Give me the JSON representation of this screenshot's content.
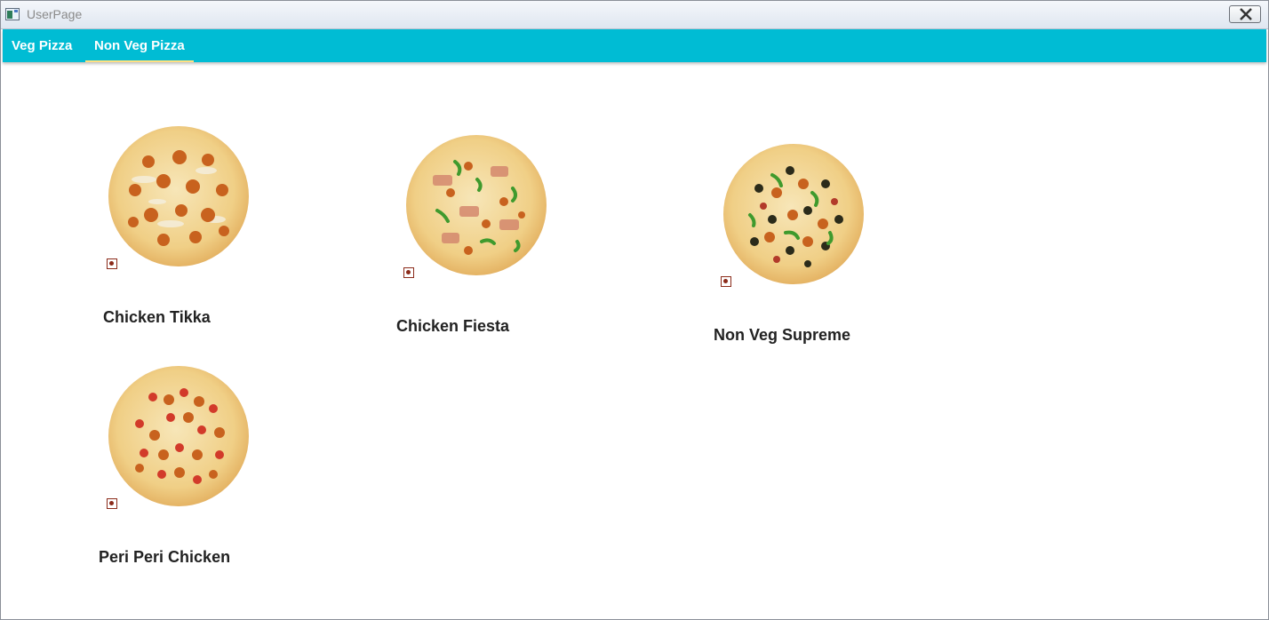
{
  "window": {
    "title": "UserPage"
  },
  "tabs": [
    {
      "label": "Veg Pizza",
      "active": false
    },
    {
      "label": "Non Veg Pizza",
      "active": true
    }
  ],
  "pizzas": [
    {
      "name": "Chicken Tikka",
      "icon": "non-veg-icon",
      "topping_colors": [
        "#c8621e",
        "#f4efe0"
      ]
    },
    {
      "name": "Chicken Fiesta",
      "icon": "non-veg-icon",
      "topping_colors": [
        "#d4886e",
        "#3f9a2d",
        "#c8621e"
      ]
    },
    {
      "name": "Non Veg Supreme",
      "icon": "non-veg-icon",
      "topping_colors": [
        "#2b2b1a",
        "#3f9a2d",
        "#c8621e",
        "#b23a2a"
      ]
    },
    {
      "name": "Peri Peri Chicken",
      "icon": "non-veg-icon",
      "topping_colors": [
        "#d23a2a",
        "#c8621e"
      ]
    }
  ],
  "colors": {
    "accent": "#00bcd4",
    "tab_indicator": "#ffe082",
    "non_veg_mark": "#8b2b1a"
  }
}
